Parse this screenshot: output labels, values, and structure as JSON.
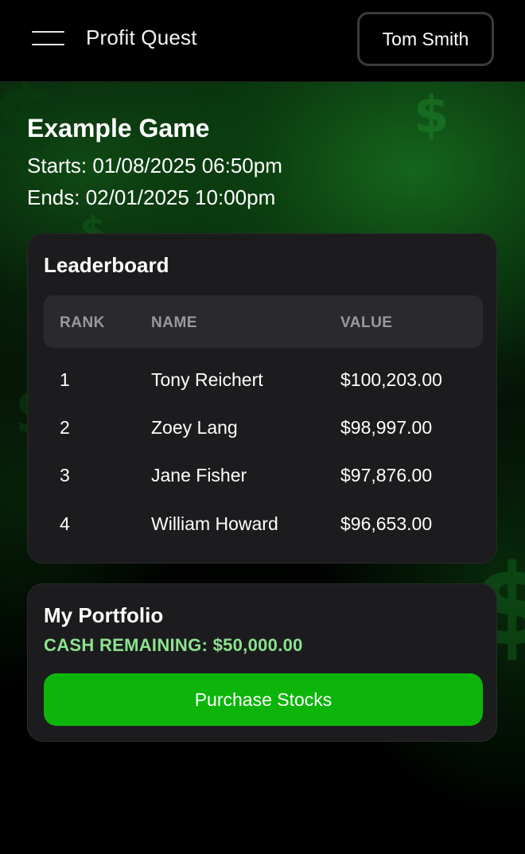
{
  "header": {
    "menu_icon": "hamburger-menu-icon",
    "app_title": "Profit Quest",
    "user_name": "Tom Smith"
  },
  "game": {
    "title": "Example Game",
    "starts": "Starts: 01/08/2025 06:50pm",
    "ends": "Ends: 02/01/2025 10:00pm"
  },
  "leaderboard": {
    "title": "Leaderboard",
    "columns": [
      "RANK",
      "NAME",
      "VALUE"
    ],
    "rows": [
      {
        "rank": "1",
        "name": "Tony Reichert",
        "value": "$100,203.00"
      },
      {
        "rank": "2",
        "name": "Zoey Lang",
        "value": "$98,997.00"
      },
      {
        "rank": "3",
        "name": "Jane Fisher",
        "value": "$97,876.00"
      },
      {
        "rank": "4",
        "name": "William Howard",
        "value": "$96,653.00"
      }
    ]
  },
  "portfolio": {
    "title": "My Portfolio",
    "cash_remaining": "CASH REMAINING: $50,000.00",
    "purchase_button": "Purchase Stocks"
  },
  "colors": {
    "background": "#000000",
    "accent_green": "#0db50b",
    "cash_text": "#8ce38f",
    "card_bg": "#1c1c1e",
    "table_header_bg": "#2a2a2c"
  }
}
